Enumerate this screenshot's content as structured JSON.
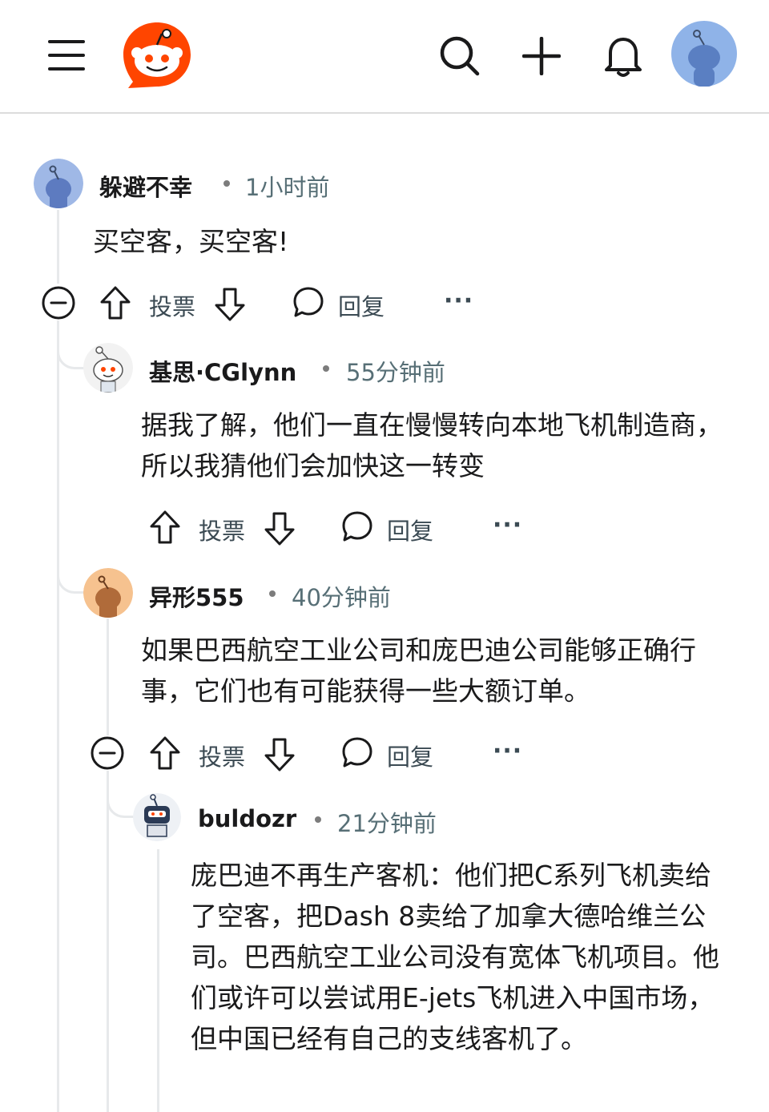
{
  "colors": {
    "brand": "#ff4500",
    "thread_line": "#e7e9eb",
    "meta_text": "#576f76"
  },
  "icons": [
    "menu-icon",
    "reddit-logo-icon",
    "search-icon",
    "plus-icon",
    "bell-icon",
    "user-avatar-icon",
    "collapse-icon",
    "upvote-icon",
    "downvote-icon",
    "reply-icon",
    "more-icon"
  ],
  "comments": [
    {
      "author": "躲避不幸",
      "time": "1小时前",
      "body": "买空客，买空客!",
      "vote_label": "投票",
      "reply_label": "回复",
      "more": "···"
    },
    {
      "author": "基思·CGlynn",
      "time": "55分钟前",
      "body": "据我了解，他们一直在慢慢转向本地飞机制造商，所以我猜他们会加快这一转变",
      "vote_label": "投票",
      "reply_label": "回复",
      "more": "···"
    },
    {
      "author": "异形555",
      "time": "40分钟前",
      "body": "如果巴西航空工业公司和庞巴迪公司能够正确行事，它们也有可能获得一些大额订单。",
      "vote_label": "投票",
      "reply_label": "回复",
      "more": "···"
    },
    {
      "author": "buldozr",
      "time": "21分钟前",
      "body": "庞巴迪不再生产客机：他们把C系列飞机卖给了空客，把Dash 8卖给了加拿大德哈维兰公司。巴西航空工业公司没有宽体飞机项目。他们或许可以尝试用E-jets飞机进入中国市场，但中国已经有自己的支线客机了。"
    }
  ]
}
